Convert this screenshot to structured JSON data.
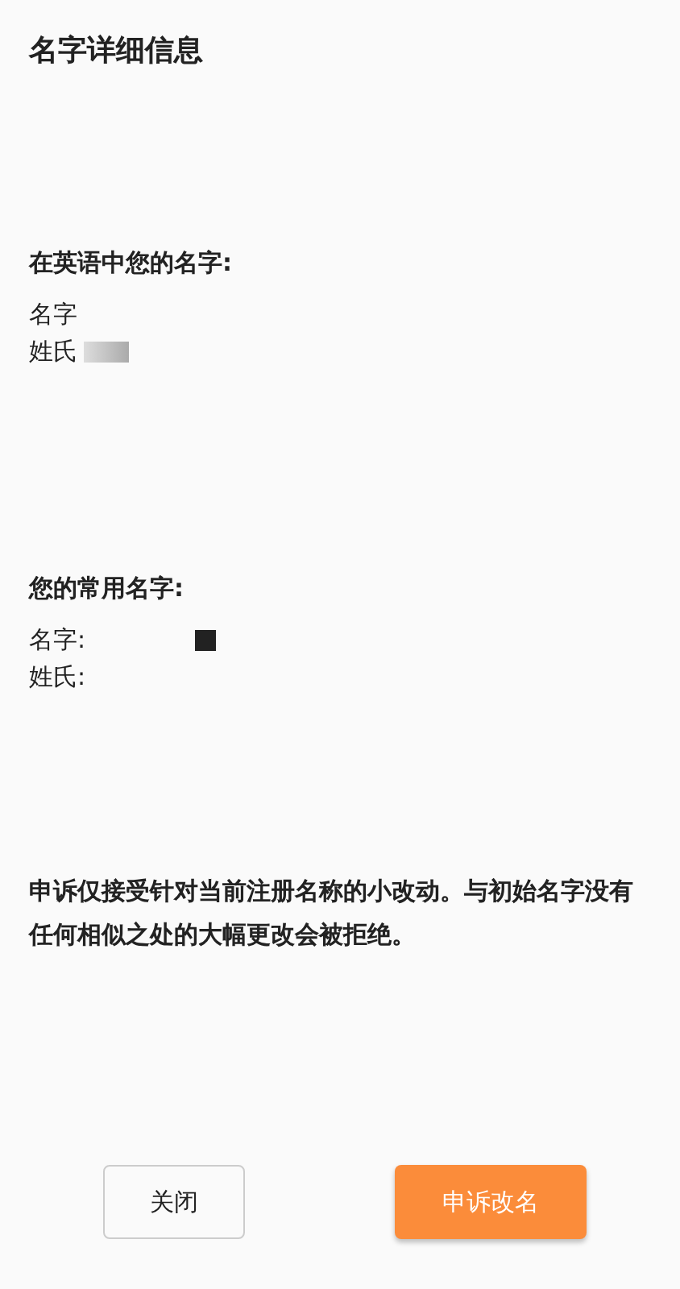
{
  "title": "名字详细信息",
  "sections": [
    {
      "heading": "在英语中您的名字:",
      "lines": [
        {
          "label": "名字"
        },
        {
          "label": "姓氏"
        }
      ]
    },
    {
      "heading": "您的常用名字:",
      "lines": [
        {
          "label": "名字:"
        },
        {
          "label": "姓氏:"
        }
      ]
    }
  ],
  "notice": "申诉仅接受针对当前注册名称的小改动。与初始名字没有任何相似之处的大幅更改会被拒绝。",
  "buttons": [
    {
      "label": "关闭",
      "kind": "secondary"
    },
    {
      "label": "申诉改名",
      "kind": "primary"
    }
  ]
}
